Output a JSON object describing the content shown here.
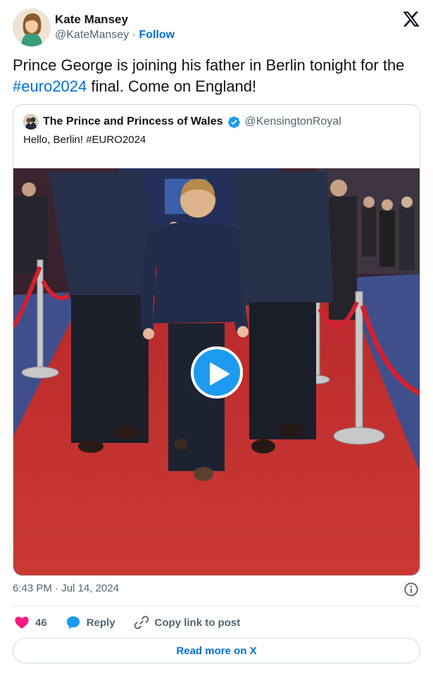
{
  "author": {
    "name": "Kate Mansey",
    "handle": "@KateMansey",
    "separator": " · ",
    "follow_label": "Follow"
  },
  "tweet": {
    "text_before": "Prince George is joining his father in Berlin tonight for the ",
    "hashtag": "#euro2024",
    "text_after": " final. Come on England!"
  },
  "quote": {
    "name": "The Prince and Princess of Wales",
    "handle": "@KensingtonRoyal",
    "text_before": "Hello, Berlin! ",
    "hashtag": "#EURO2024",
    "verified": true
  },
  "media": {
    "type": "video",
    "play_icon": "play-icon"
  },
  "meta": {
    "timestamp": "6:43 PM · Jul 14, 2024"
  },
  "actions": {
    "like_count": "46",
    "reply_label": "Reply",
    "copy_label": "Copy link to post"
  },
  "read_more_label": "Read more on X",
  "colors": {
    "link": "#006fd6",
    "like": "#f91880",
    "reply": "#1d9bf0",
    "muted": "#536471",
    "text": "#0f1419",
    "carpet": "#c42a2a",
    "rope": "#d42030"
  }
}
